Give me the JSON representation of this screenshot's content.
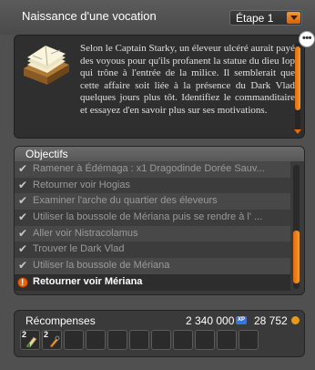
{
  "window": {
    "title": "Naissance d'une vocation",
    "step_select": {
      "value": "Étape 1"
    },
    "bubble_label": "•••"
  },
  "description": {
    "text": "Selon le Captain Starky, un éleveur ulcéré aurait payé des voyous pour qu'ils profanent la statue du dieu Iop qui trône à l'entrée de la milice. Il semblerait que cette affaire soit liée à la présence du Dark Vlad quelques jours plus tôt. Identifiez le commanditaire et essayez d'en savoir plus sur ses motivations."
  },
  "objectives": {
    "header": "Objectifs",
    "items": [
      {
        "text": "Ramener à Édémaga : x1 Dragodinde Dorée Sauv...",
        "done": true
      },
      {
        "text": "Retourner voir Hogias",
        "done": true
      },
      {
        "text": "Examiner l'arche du quartier des éleveurs",
        "done": true
      },
      {
        "text": "Utiliser la boussole de Mériana puis se rendre à l' ...",
        "done": true
      },
      {
        "text": "Aller voir Nistracolamus",
        "done": true
      },
      {
        "text": "Trouver le Dark Vlad",
        "done": true
      },
      {
        "text": "Utiliser la boussole de Mériana",
        "done": true
      },
      {
        "text": "Retourner voir Mériana",
        "done": false,
        "current": true
      }
    ]
  },
  "rewards": {
    "title": "Récompenses",
    "xp": "2 340 000",
    "xp_icon": "XP",
    "kamas": "28 752",
    "item_slots": [
      {
        "qty": "2",
        "icon": "scroll-item-icon"
      },
      {
        "qty": "2",
        "icon": "potion-item-icon"
      },
      {},
      {},
      {},
      {},
      {},
      {},
      {},
      {},
      {}
    ]
  },
  "colors": {
    "accent": "#e56b0b",
    "background": "#505050"
  }
}
